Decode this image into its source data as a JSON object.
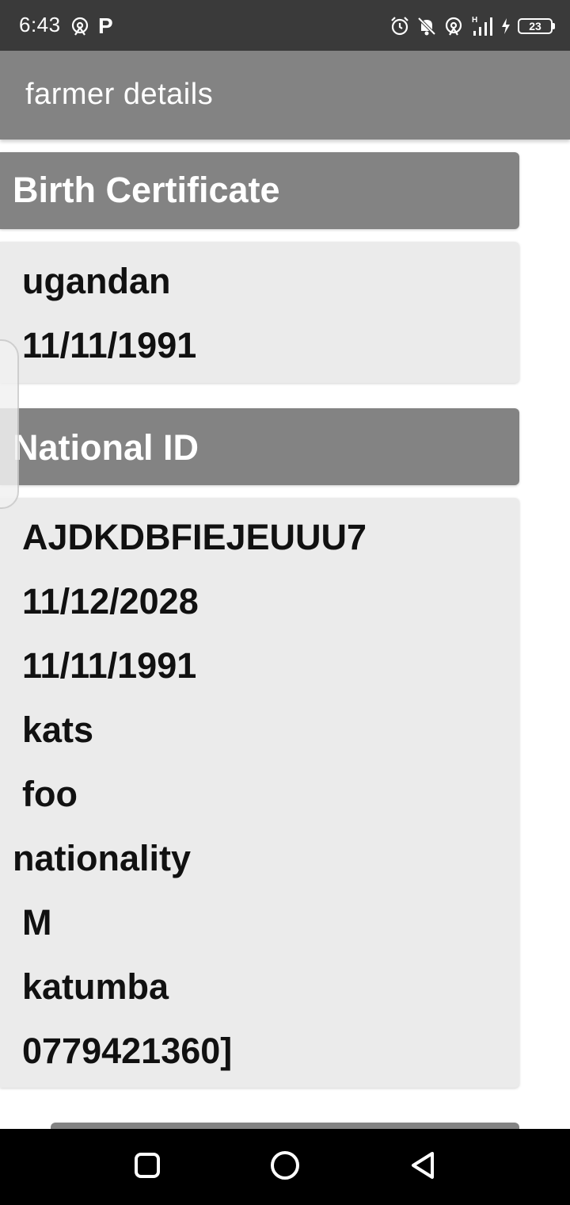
{
  "status_bar": {
    "time": "6:43",
    "left_icons": [
      "hotspot-icon",
      "parking-icon"
    ],
    "parking_glyph": "P",
    "right_icons": [
      "alarm-icon",
      "bell-off-icon",
      "hotspot-icon",
      "signal-icon",
      "charging-icon",
      "battery-icon"
    ],
    "network_type": "H",
    "battery_level": "23"
  },
  "app_bar": {
    "title": "farmer details"
  },
  "birth_certificate": {
    "title": "Birth Certificate",
    "fields": [
      "ugandan",
      "11/11/1991"
    ]
  },
  "national_id": {
    "title": "National ID",
    "fields": [
      "AJDKDBFIEJEUUU7",
      "11/12/2028",
      "11/11/1991",
      "kats",
      "foo",
      "nationality",
      "M",
      "katumba",
      "0779421360]"
    ]
  },
  "nav_bar": {
    "buttons": [
      "recents-button",
      "home-button",
      "back-button"
    ]
  },
  "colors": {
    "status_bar": "#3a3a3a",
    "app_bar": "#838383",
    "header": "#838383",
    "card": "#ebebeb",
    "nav_bar": "#000000"
  }
}
